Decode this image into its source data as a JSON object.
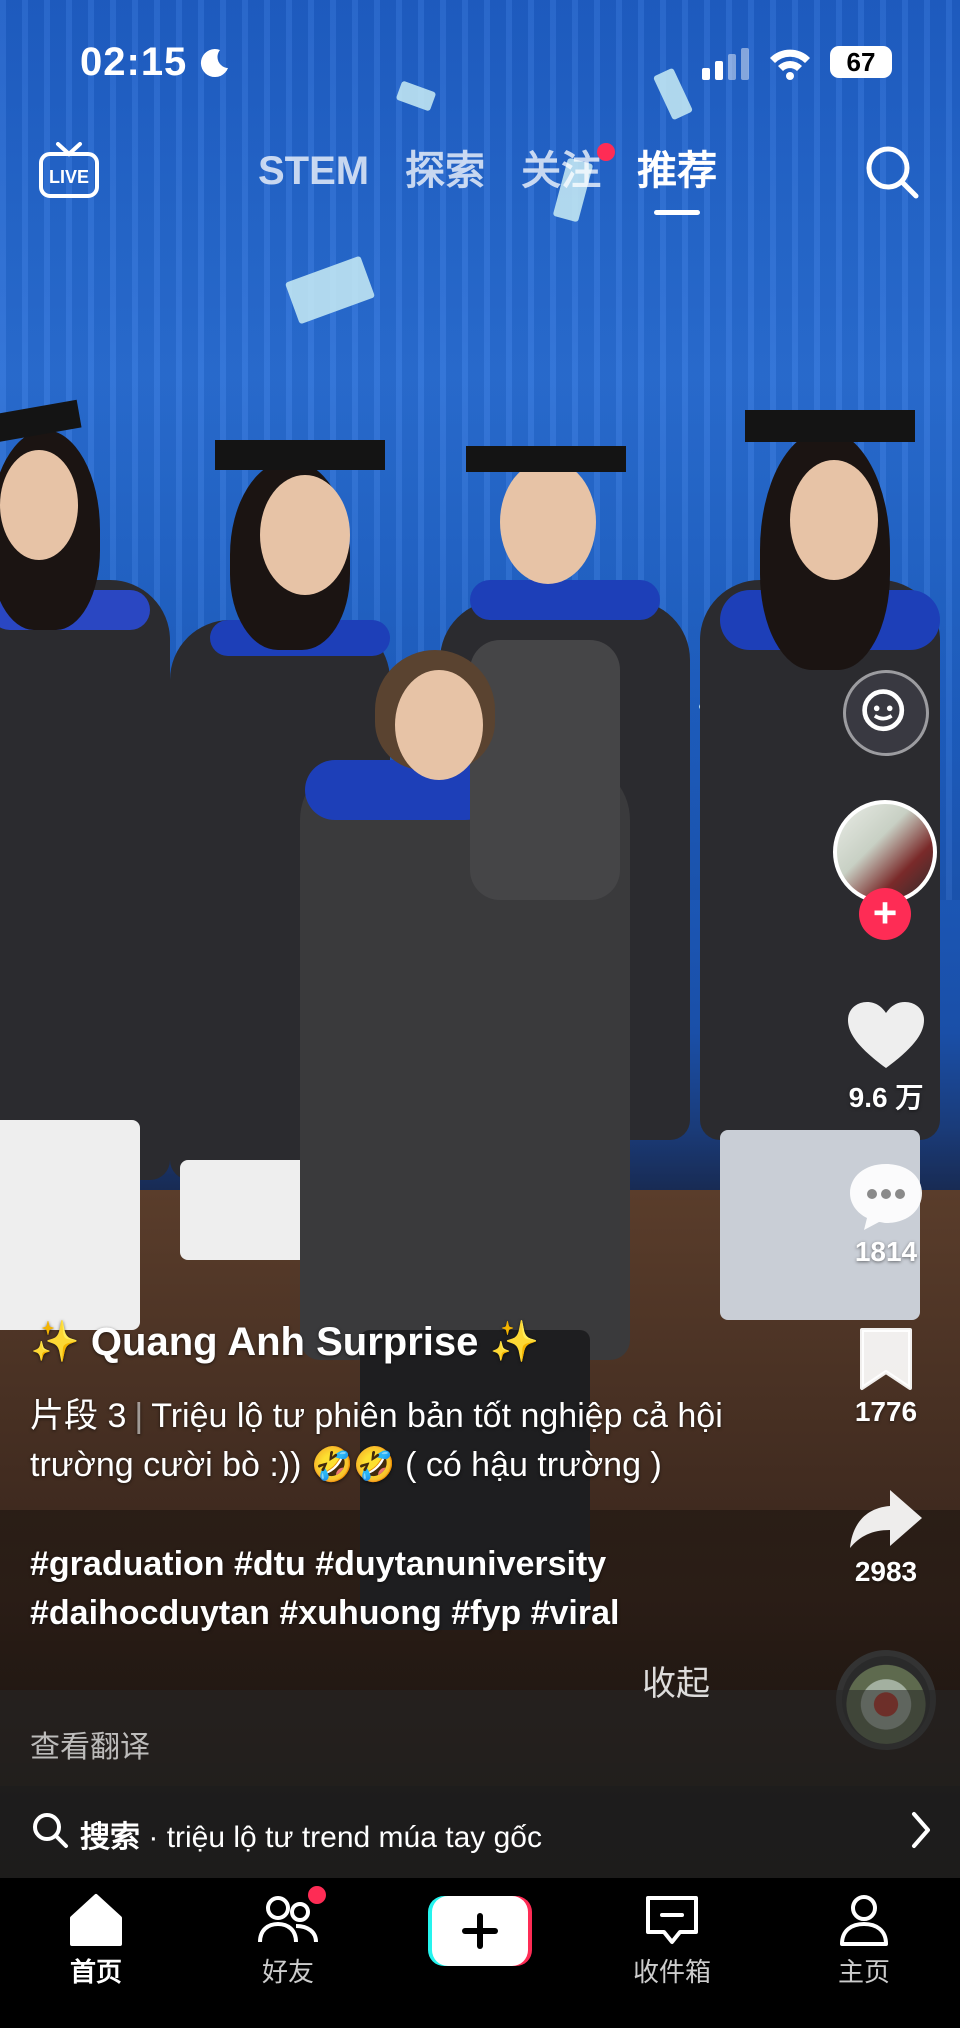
{
  "status_bar": {
    "time": "02:15",
    "battery": "67"
  },
  "top_nav": {
    "live_label": "LIVE",
    "tabs": [
      {
        "label": "STEM",
        "active": false
      },
      {
        "label": "探索",
        "active": false
      },
      {
        "label": "关注",
        "active": false,
        "has_dot": true
      },
      {
        "label": "推荐",
        "active": true
      }
    ]
  },
  "rail": {
    "likes": "9.6 万",
    "comments": "1814",
    "favorites": "1776",
    "shares": "2983"
  },
  "caption": {
    "author": "✨ Quang Anh Surprise ✨",
    "part": "片段 3",
    "separator": "|",
    "description": "Triệu lộ tư phiên bản tốt nghiệp cả hội trường cười bò :)) 🤣🤣 ( có hậu trường )",
    "hashtags_line1": "#graduation #dtu #duytanuniversity",
    "hashtags_line2": "#daihocduytan #xuhuong #fyp #viral",
    "collapse": "收起",
    "translate": "查看翻译"
  },
  "search_suggestion": {
    "prefix": "搜索",
    "dot": "·",
    "query": "triệu lộ tư trend múa tay gốc"
  },
  "bottom_nav": {
    "home": "首页",
    "friends": "好友",
    "inbox": "收件箱",
    "profile": "主页"
  },
  "colors": {
    "accent": "#fe2c55",
    "cyan": "#25f4ee"
  }
}
